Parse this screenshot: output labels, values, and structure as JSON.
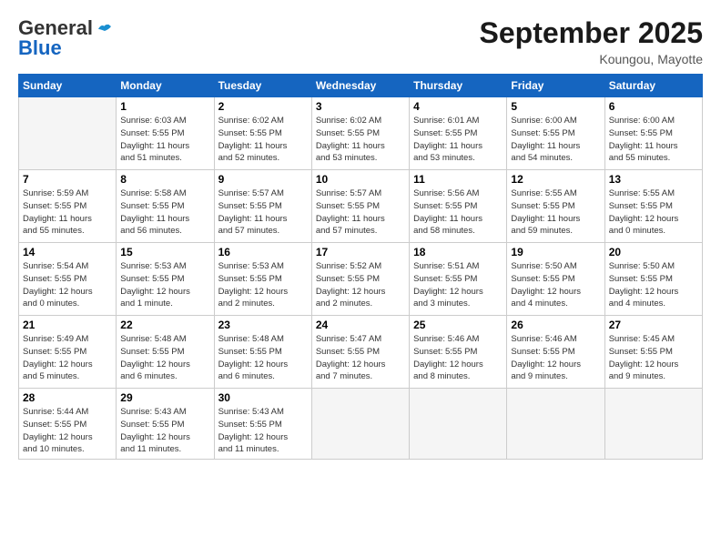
{
  "header": {
    "logo_general": "General",
    "logo_blue": "Blue",
    "month_title": "September 2025",
    "location": "Koungou, Mayotte"
  },
  "weekdays": [
    "Sunday",
    "Monday",
    "Tuesday",
    "Wednesday",
    "Thursday",
    "Friday",
    "Saturday"
  ],
  "weeks": [
    [
      {
        "day": "",
        "info": ""
      },
      {
        "day": "1",
        "info": "Sunrise: 6:03 AM\nSunset: 5:55 PM\nDaylight: 11 hours\nand 51 minutes."
      },
      {
        "day": "2",
        "info": "Sunrise: 6:02 AM\nSunset: 5:55 PM\nDaylight: 11 hours\nand 52 minutes."
      },
      {
        "day": "3",
        "info": "Sunrise: 6:02 AM\nSunset: 5:55 PM\nDaylight: 11 hours\nand 53 minutes."
      },
      {
        "day": "4",
        "info": "Sunrise: 6:01 AM\nSunset: 5:55 PM\nDaylight: 11 hours\nand 53 minutes."
      },
      {
        "day": "5",
        "info": "Sunrise: 6:00 AM\nSunset: 5:55 PM\nDaylight: 11 hours\nand 54 minutes."
      },
      {
        "day": "6",
        "info": "Sunrise: 6:00 AM\nSunset: 5:55 PM\nDaylight: 11 hours\nand 55 minutes."
      }
    ],
    [
      {
        "day": "7",
        "info": "Sunrise: 5:59 AM\nSunset: 5:55 PM\nDaylight: 11 hours\nand 55 minutes."
      },
      {
        "day": "8",
        "info": "Sunrise: 5:58 AM\nSunset: 5:55 PM\nDaylight: 11 hours\nand 56 minutes."
      },
      {
        "day": "9",
        "info": "Sunrise: 5:57 AM\nSunset: 5:55 PM\nDaylight: 11 hours\nand 57 minutes."
      },
      {
        "day": "10",
        "info": "Sunrise: 5:57 AM\nSunset: 5:55 PM\nDaylight: 11 hours\nand 57 minutes."
      },
      {
        "day": "11",
        "info": "Sunrise: 5:56 AM\nSunset: 5:55 PM\nDaylight: 11 hours\nand 58 minutes."
      },
      {
        "day": "12",
        "info": "Sunrise: 5:55 AM\nSunset: 5:55 PM\nDaylight: 11 hours\nand 59 minutes."
      },
      {
        "day": "13",
        "info": "Sunrise: 5:55 AM\nSunset: 5:55 PM\nDaylight: 12 hours\nand 0 minutes."
      }
    ],
    [
      {
        "day": "14",
        "info": "Sunrise: 5:54 AM\nSunset: 5:55 PM\nDaylight: 12 hours\nand 0 minutes."
      },
      {
        "day": "15",
        "info": "Sunrise: 5:53 AM\nSunset: 5:55 PM\nDaylight: 12 hours\nand 1 minute."
      },
      {
        "day": "16",
        "info": "Sunrise: 5:53 AM\nSunset: 5:55 PM\nDaylight: 12 hours\nand 2 minutes."
      },
      {
        "day": "17",
        "info": "Sunrise: 5:52 AM\nSunset: 5:55 PM\nDaylight: 12 hours\nand 2 minutes."
      },
      {
        "day": "18",
        "info": "Sunrise: 5:51 AM\nSunset: 5:55 PM\nDaylight: 12 hours\nand 3 minutes."
      },
      {
        "day": "19",
        "info": "Sunrise: 5:50 AM\nSunset: 5:55 PM\nDaylight: 12 hours\nand 4 minutes."
      },
      {
        "day": "20",
        "info": "Sunrise: 5:50 AM\nSunset: 5:55 PM\nDaylight: 12 hours\nand 4 minutes."
      }
    ],
    [
      {
        "day": "21",
        "info": "Sunrise: 5:49 AM\nSunset: 5:55 PM\nDaylight: 12 hours\nand 5 minutes."
      },
      {
        "day": "22",
        "info": "Sunrise: 5:48 AM\nSunset: 5:55 PM\nDaylight: 12 hours\nand 6 minutes."
      },
      {
        "day": "23",
        "info": "Sunrise: 5:48 AM\nSunset: 5:55 PM\nDaylight: 12 hours\nand 6 minutes."
      },
      {
        "day": "24",
        "info": "Sunrise: 5:47 AM\nSunset: 5:55 PM\nDaylight: 12 hours\nand 7 minutes."
      },
      {
        "day": "25",
        "info": "Sunrise: 5:46 AM\nSunset: 5:55 PM\nDaylight: 12 hours\nand 8 minutes."
      },
      {
        "day": "26",
        "info": "Sunrise: 5:46 AM\nSunset: 5:55 PM\nDaylight: 12 hours\nand 9 minutes."
      },
      {
        "day": "27",
        "info": "Sunrise: 5:45 AM\nSunset: 5:55 PM\nDaylight: 12 hours\nand 9 minutes."
      }
    ],
    [
      {
        "day": "28",
        "info": "Sunrise: 5:44 AM\nSunset: 5:55 PM\nDaylight: 12 hours\nand 10 minutes."
      },
      {
        "day": "29",
        "info": "Sunrise: 5:43 AM\nSunset: 5:55 PM\nDaylight: 12 hours\nand 11 minutes."
      },
      {
        "day": "30",
        "info": "Sunrise: 5:43 AM\nSunset: 5:55 PM\nDaylight: 12 hours\nand 11 minutes."
      },
      {
        "day": "",
        "info": ""
      },
      {
        "day": "",
        "info": ""
      },
      {
        "day": "",
        "info": ""
      },
      {
        "day": "",
        "info": ""
      }
    ]
  ]
}
